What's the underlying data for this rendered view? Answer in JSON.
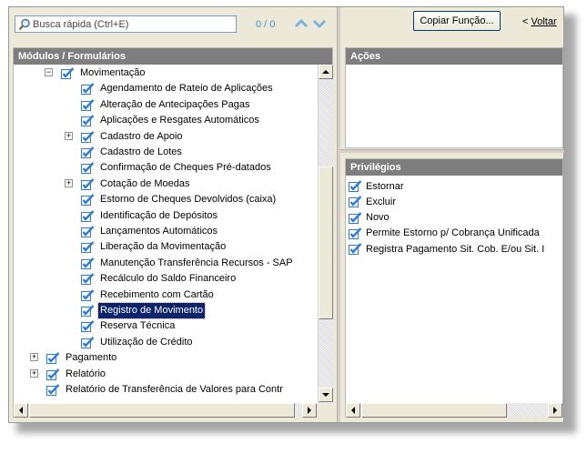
{
  "search": {
    "placeholder": "Busca rápida (Ctrl+E)",
    "value": "",
    "counter": "0 / 0"
  },
  "modules_panel": {
    "title": "Módulos / Formulários"
  },
  "tree": [
    {
      "label": "Movimentação",
      "level": 1,
      "expander": "−",
      "checked": true
    },
    {
      "label": "Agendamento de Rateio de Aplicações",
      "level": 2,
      "checked": true
    },
    {
      "label": "Alteração de Antecipações Pagas",
      "level": 2,
      "checked": true
    },
    {
      "label": "Aplicações e Resgates Automáticos",
      "level": 2,
      "checked": true
    },
    {
      "label": "Cadastro de Apoio",
      "level": 2,
      "expander": "+",
      "checked": true
    },
    {
      "label": "Cadastro de Lotes",
      "level": 2,
      "checked": true
    },
    {
      "label": "Confirmação de Cheques Pré-datados",
      "level": 2,
      "checked": true
    },
    {
      "label": "Cotação de Moedas",
      "level": 2,
      "expander": "+",
      "checked": true
    },
    {
      "label": "Estorno de Cheques Devolvidos (caixa)",
      "level": 2,
      "checked": true
    },
    {
      "label": "Identificação de Depósitos",
      "level": 2,
      "checked": true
    },
    {
      "label": "Lançamentos Automáticos",
      "level": 2,
      "checked": true
    },
    {
      "label": "Liberação da Movimentação",
      "level": 2,
      "checked": true
    },
    {
      "label": "Manutenção Transferência Recursos - SAP",
      "level": 2,
      "checked": true
    },
    {
      "label": "Recálculo do Saldo Financeiro",
      "level": 2,
      "checked": true
    },
    {
      "label": "Recebimento com Cartão",
      "level": 2,
      "checked": true
    },
    {
      "label": "Registro de Movimento",
      "level": 2,
      "checked": true,
      "selected": true
    },
    {
      "label": "Reserva Técnica",
      "level": 2,
      "checked": true
    },
    {
      "label": "Utilização de Crédito",
      "level": 2,
      "checked": true
    },
    {
      "label": "Pagamento",
      "level": 0,
      "expander": "+",
      "checked": true
    },
    {
      "label": "Relatório",
      "level": 0,
      "expander": "+",
      "checked": true
    },
    {
      "label": "Relatório de Transferência de Valores para Contr",
      "level": 0,
      "checked": true
    }
  ],
  "toolbar": {
    "copy_label": "Copiar Função...",
    "back_prefix": "< ",
    "back_label": "Voltar"
  },
  "actions_panel": {
    "title": "Ações"
  },
  "privileges_panel": {
    "title": "Privilégios",
    "items": [
      {
        "label": "Estornar",
        "checked": true
      },
      {
        "label": "Excluir",
        "checked": true
      },
      {
        "label": "Novo",
        "checked": true
      },
      {
        "label": "Permite Estorno p/ Cobrança Unificada",
        "checked": true
      },
      {
        "label": "Registra Pagamento Sit. Cob. E/ou Sit. I",
        "checked": true
      }
    ]
  },
  "colors": {
    "panel_header": "#7e7e7e",
    "selection": "#0a246a",
    "check": "#2e7bd1",
    "counter": "#4a8ec8"
  }
}
